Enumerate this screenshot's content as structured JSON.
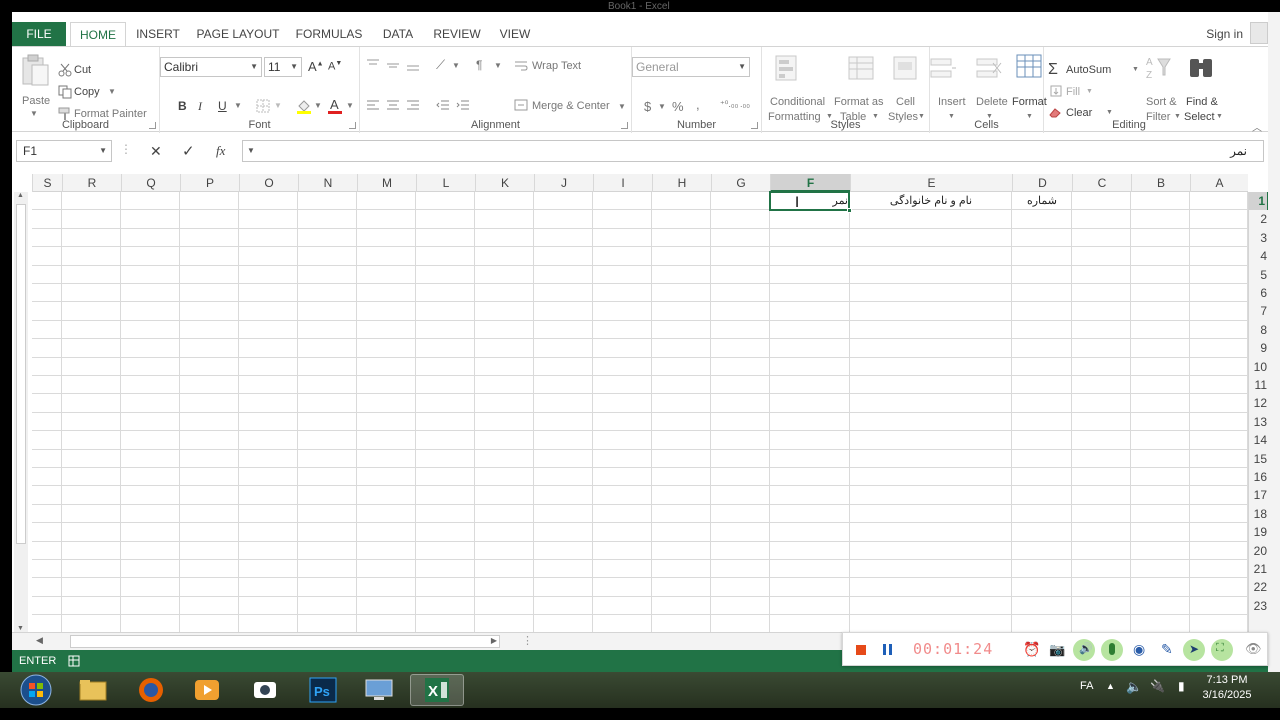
{
  "window": {
    "title": "Book1 - Excel"
  },
  "tabs": [
    "FILE",
    "HOME",
    "INSERT",
    "PAGE LAYOUT",
    "FORMULAS",
    "DATA",
    "REVIEW",
    "VIEW"
  ],
  "signin": "Sign in",
  "ribbon": {
    "clipboard": {
      "paste": "Paste",
      "cut": "Cut",
      "copy": "Copy",
      "format_painter": "Format Painter",
      "label": "Clipboard"
    },
    "font": {
      "name": "Calibri",
      "size": "11",
      "bold": "B",
      "italic": "I",
      "underline": "U",
      "label": "Font"
    },
    "alignment": {
      "wrap_text": "Wrap Text",
      "merge_center": "Merge & Center",
      "label": "Alignment"
    },
    "number": {
      "format": "General",
      "currency": "$",
      "percent": "%",
      "comma": ",",
      "label": "Number"
    },
    "styles": {
      "conditional": [
        "Conditional",
        "Formatting"
      ],
      "format_table": [
        "Format as",
        "Table"
      ],
      "cell_styles": [
        "Cell",
        "Styles"
      ],
      "label": "Styles"
    },
    "cells": {
      "insert": "Insert",
      "delete": "Delete",
      "format": "Format",
      "label": "Cells"
    },
    "editing": {
      "autosum": "AutoSum",
      "fill": "Fill",
      "clear": "Clear",
      "sort": [
        "Sort &",
        "Filter"
      ],
      "find": [
        "Find &",
        "Select"
      ],
      "label": "Editing"
    }
  },
  "formula_bar": {
    "name_box": "F1",
    "fx": "fx",
    "content": "نمر"
  },
  "columns": [
    "S",
    "R",
    "Q",
    "P",
    "O",
    "N",
    "M",
    "L",
    "K",
    "J",
    "I",
    "H",
    "G",
    "F",
    "E",
    "D",
    "C",
    "B",
    "A"
  ],
  "rows": [
    "1",
    "2",
    "3",
    "4",
    "5",
    "6",
    "7",
    "8",
    "9",
    "10",
    "11",
    "12",
    "13",
    "14",
    "15",
    "16",
    "17",
    "18",
    "19",
    "20",
    "21",
    "22",
    "23"
  ],
  "cells": {
    "D1": "شماره",
    "E1": "نام و نام خانوادگی",
    "F1": "نمر"
  },
  "selected_cell": "F1",
  "status": {
    "mode": "ENTER"
  },
  "recorder": {
    "timer": "00:01:24"
  },
  "tray": {
    "lang": "FA",
    "time": "7:13 PM",
    "date": "3/16/2025"
  },
  "colors": {
    "excel_green": "#217346",
    "taskbar": "#2e3a28"
  }
}
